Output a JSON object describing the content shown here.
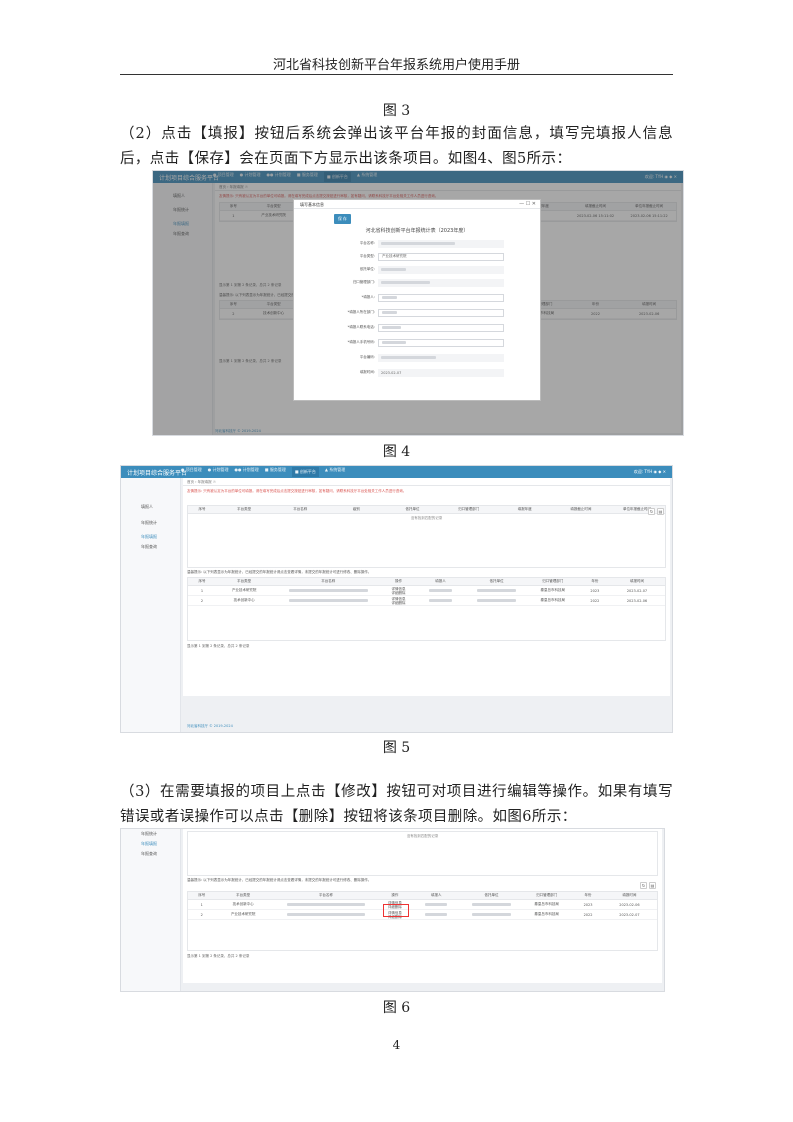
{
  "header": {
    "title": "河北省科技创新平台年报系统用户使用手册"
  },
  "captions": {
    "fig3": "图 3",
    "fig4": "图 4",
    "fig5": "图 5",
    "fig6": "图 6"
  },
  "paragraphs": {
    "p2": "（2）点击【填报】按钮后系统会弹出该平台年报的封面信息，填写完填报人信息后，点击【保存】会在页面下方显示出该条项目。如图4、图5所示：",
    "p3": "（3）在需要填报的项目上点击【修改】按钮可对项目进行编辑等操作。如果有填写错误或者误操作可以点击【删除】按钮将该条项目删除。如图6所示："
  },
  "page_number": "4",
  "app": {
    "brand": "计划项目综合服务平台",
    "nav": [
      "● 项目管理",
      "● 计划管理",
      "●● 计划管理",
      "■ 服务管理",
      "■ 创新平台",
      "▲ 系统管理"
    ],
    "user": "欢迎: TYH  ◉   ◆   ✕",
    "side_items": [
      "填报人",
      "年报统计",
      "年报填报",
      "年报查询"
    ],
    "tab": "首页  ›  年报填报 ☉",
    "warning": "友情提示: 只有被认定为平台的单位可填报。请在填写完成后点击提交按钮进行审核，如有疑问，请联系科技厅平台处相关工作人员进行咨询。",
    "tip": "温馨提示: 以下列表显示为年报统计，已经提交的年报统计请点击查看详情，未提交的年报统计可进行修改、删除操作。",
    "empty": "没有找到匹配的记录",
    "footer": "显示第 1 到第 2 条记录，总共 2 条记录",
    "copyright": "河北省科技厅 © 2019-2024",
    "cols_top": [
      "序号",
      "平台类型",
      "平台名称",
      "级别",
      "依托单位",
      "归口管理部门",
      "填报年度",
      "填报截止时间",
      "单位年报截止时间"
    ],
    "cols_bottom": [
      "序号",
      "平台类型",
      "平台名称",
      "操作",
      "填报人",
      "依托单位",
      "归口管理部门",
      "年份",
      "填报时间"
    ],
    "rows": [
      {
        "no": "1",
        "type": "产业技术研究院",
        "ops": "详情信息\n详细删除",
        "dept": "秦皇岛市科技局",
        "year": "2023",
        "time": "2023-02-07"
      },
      {
        "no": "2",
        "type": "技术创新中心",
        "ops": "详情信息\n详细删除",
        "dept": "秦皇岛市科技局",
        "year": "2022",
        "time": "2023-02-06"
      }
    ],
    "fig4_row": {
      "no": "1",
      "type": "产业技术研究院",
      "deadline": "2023-02-06 15:11:02",
      "deadline2": "2023-02-06 15:11:22"
    }
  },
  "modal": {
    "title": "填写基本信息",
    "close": "— ☐ ✕",
    "save": "保 存",
    "report_title": "河北省科技创新平台年报统计表（2023年度）",
    "fields": [
      {
        "label": "平台名称:",
        "value": ""
      },
      {
        "label": "平台类型:",
        "value": "产业技术研究院"
      },
      {
        "label": "依托单位:",
        "value": ""
      },
      {
        "label": "归口管理部门:",
        "value": ""
      },
      {
        "label": "*填报人:",
        "value": ""
      },
      {
        "label": "*填报人所在部门:",
        "value": ""
      },
      {
        "label": "*填报人联系电话:",
        "value": ""
      },
      {
        "label": "*填报人手机号码:",
        "value": ""
      },
      {
        "label": "平台编码:",
        "value": ""
      },
      {
        "label": "填报时间:",
        "value": "2023-02-07"
      }
    ]
  }
}
